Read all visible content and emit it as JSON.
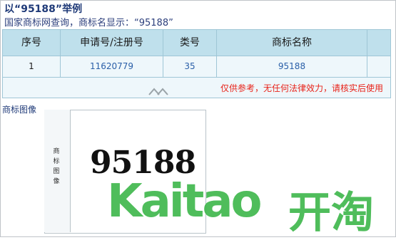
{
  "header": {
    "title": "以“95188”举例",
    "subtitle": "国家商标网查询，商标名显示：“95188”"
  },
  "table": {
    "columns": [
      "序号",
      "申请号/注册号",
      "类号",
      "商标名称"
    ],
    "rows": [
      {
        "index": "1",
        "reg_no": "11620779",
        "class_no": "35",
        "name": "95188"
      }
    ],
    "disclaimer": "仅供参考，无任何法律效力，请核实后使用"
  },
  "trademark_image": {
    "label": "商标图像",
    "side_label": [
      "商",
      "标",
      "图",
      "像"
    ],
    "mark_text": "95188"
  },
  "watermark": {
    "latin": "Kaitao",
    "chinese": "开淘"
  },
  "colors": {
    "header_bg": "#bfe0ec",
    "link": "#2a5fa8",
    "warning": "#e8231a",
    "watermark": "#3cb64a"
  }
}
